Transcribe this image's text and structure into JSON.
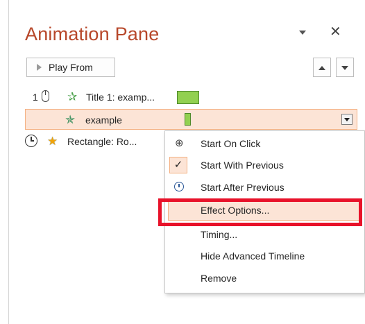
{
  "pane": {
    "title": "Animation Pane",
    "play_label": "Play From"
  },
  "animation_list": [
    {
      "order": "1",
      "label": "Title 1: examp...",
      "trigger": "on-click",
      "selected": false
    },
    {
      "order": "",
      "label": "example",
      "trigger": "with-previous",
      "selected": true
    },
    {
      "order": "",
      "label": "Rectangle: Ro...",
      "trigger": "after-previous",
      "selected": false
    }
  ],
  "context_menu": {
    "items": [
      {
        "label": "Start On Click",
        "icon": "mouse-click-icon",
        "checked": false
      },
      {
        "label": "Start With Previous",
        "icon": "checkmark-icon",
        "checked": true
      },
      {
        "label": "Start After Previous",
        "icon": "clock-icon",
        "checked": false
      },
      {
        "label": "Effect Options...",
        "highlighted": true
      },
      {
        "label": "Timing..."
      },
      {
        "label": "Hide Advanced Timeline"
      },
      {
        "label": "Remove"
      }
    ]
  },
  "colors": {
    "title": "#b7472a",
    "highlight_fill": "#fce4d6",
    "highlight_border": "#f4b183",
    "timeline_bar": "#92d050",
    "annotation_frame": "#e8122a"
  }
}
